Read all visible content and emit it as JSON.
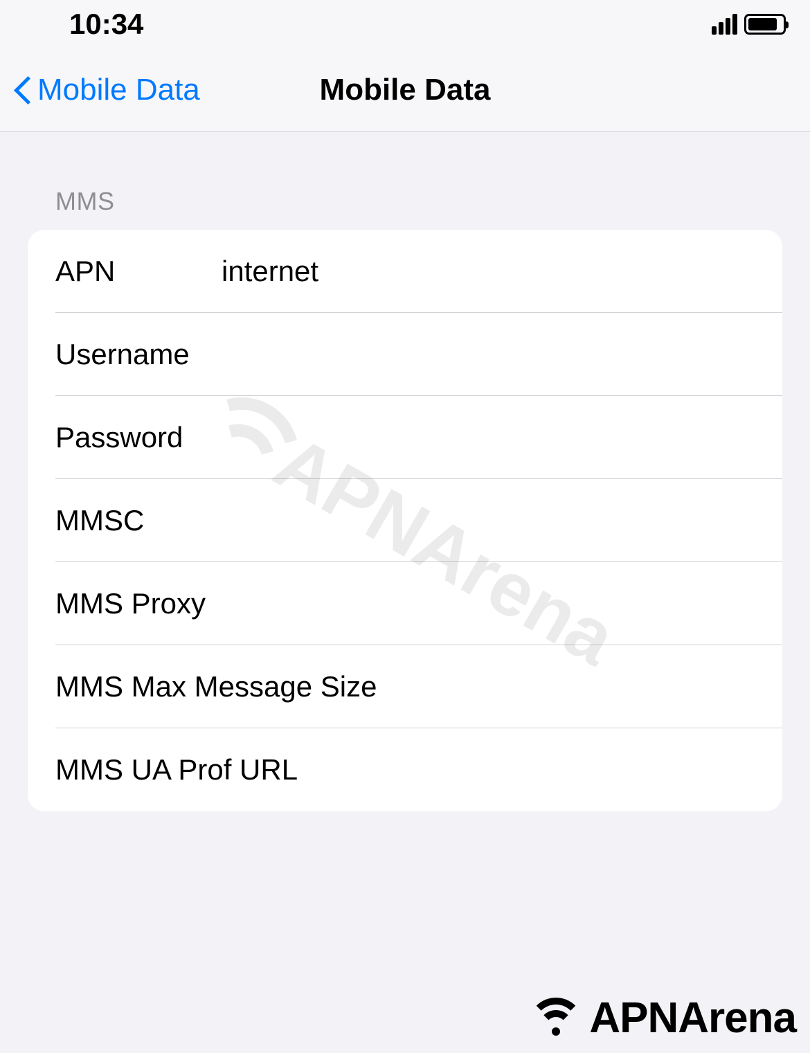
{
  "status_bar": {
    "time": "10:34"
  },
  "nav": {
    "back_label": "Mobile Data",
    "title": "Mobile Data"
  },
  "section": {
    "header": "MMS"
  },
  "fields": {
    "apn": {
      "label": "APN",
      "value": "internet"
    },
    "username": {
      "label": "Username",
      "value": ""
    },
    "password": {
      "label": "Password",
      "value": ""
    },
    "mmsc": {
      "label": "MMSC",
      "value": ""
    },
    "mms_proxy": {
      "label": "MMS Proxy",
      "value": ""
    },
    "mms_max_size": {
      "label": "MMS Max Message Size",
      "value": ""
    },
    "mms_ua_prof": {
      "label": "MMS UA Prof URL",
      "value": ""
    }
  },
  "watermark": {
    "text": "APNArena"
  },
  "footer": {
    "logo_text": "APNArena"
  }
}
